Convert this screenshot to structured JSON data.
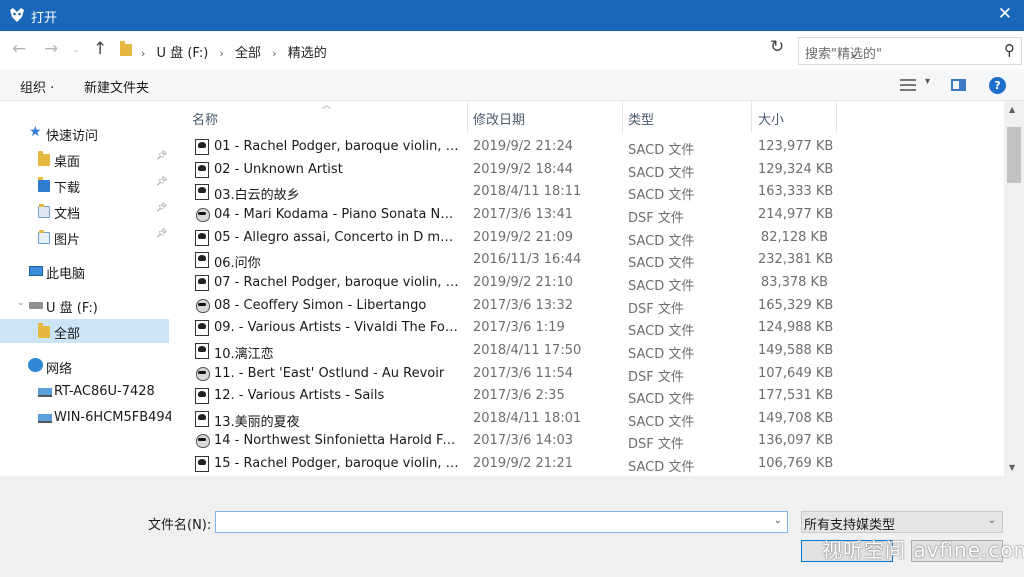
{
  "window": {
    "title": "打开",
    "close_glyph": "✕"
  },
  "address": {
    "breadcrumbs": [
      "U 盘 (F:)",
      "全部",
      "精选的"
    ],
    "search_placeholder": "搜索\"精选的\""
  },
  "toolbar": {
    "organize": "组织 ·",
    "new_folder": "新建文件夹"
  },
  "nav": {
    "quick_access": "快速访问",
    "quick_items": [
      {
        "label": "桌面",
        "pinned": true
      },
      {
        "label": "下载",
        "pinned": true
      },
      {
        "label": "文档",
        "pinned": true
      },
      {
        "label": "图片",
        "pinned": true
      }
    ],
    "this_pc": "此电脑",
    "drive": "U 盘 (F:)",
    "drive_child": "全部",
    "network": "网络",
    "network_items": [
      "RT-AC86U-7428",
      "WIN-6HCM5FB494"
    ]
  },
  "columns": {
    "name": "名称",
    "date": "修改日期",
    "type": "类型",
    "size": "大小"
  },
  "files": [
    {
      "name": "01 - Rachel Podger, baroque violin, A...",
      "date": "2019/9/2 21:24",
      "type": "SACD 文件",
      "size": "123,977 KB",
      "icon": "sacd-file-icon"
    },
    {
      "name": "02 - Unknown Artist",
      "date": "2019/9/2 18:44",
      "type": "SACD 文件",
      "size": "129,324 KB",
      "icon": "sacd-file-icon"
    },
    {
      "name": "03.白云的故乡",
      "date": "2018/4/11 18:11",
      "type": "SACD 文件",
      "size": "163,333 KB",
      "icon": "sacd-file-icon"
    },
    {
      "name": "04 - Mari Kodama - Piano Sonata No....",
      "date": "2017/3/6 13:41",
      "type": "DSF 文件",
      "size": "214,977 KB",
      "icon": "dsf-file-icon"
    },
    {
      "name": "05 - Allegro assai, Concerto in D maj...",
      "date": "2019/9/2 21:09",
      "type": "SACD 文件",
      "size": "82,128 KB",
      "icon": "sacd-file-icon"
    },
    {
      "name": "06.问你",
      "date": "2016/11/3 16:44",
      "type": "SACD 文件",
      "size": "232,381 KB",
      "icon": "sacd-file-icon"
    },
    {
      "name": "07 - Rachel Podger, baroque violin, A...",
      "date": "2019/9/2 21:10",
      "type": "SACD 文件",
      "size": "83,378 KB",
      "icon": "sacd-file-icon"
    },
    {
      "name": "08 - Ceoffery Simon - Libertango",
      "date": "2017/3/6 13:32",
      "type": "DSF 文件",
      "size": "165,329 KB",
      "icon": "dsf-file-icon"
    },
    {
      "name": "09. - Various Artists - Vivaldi The Fou...",
      "date": "2017/3/6 1:19",
      "type": "SACD 文件",
      "size": "124,988 KB",
      "icon": "sacd-file-icon"
    },
    {
      "name": "10.漓江恋",
      "date": "2018/4/11 17:50",
      "type": "SACD 文件",
      "size": "149,588 KB",
      "icon": "sacd-file-icon"
    },
    {
      "name": "11. - Bert 'East' Ostlund - Au Revoir",
      "date": "2017/3/6 11:54",
      "type": "DSF 文件",
      "size": "107,649 KB",
      "icon": "dsf-file-icon"
    },
    {
      "name": "12. - Various Artists - Sails",
      "date": "2017/3/6 2:35",
      "type": "SACD 文件",
      "size": "177,531 KB",
      "icon": "sacd-file-icon"
    },
    {
      "name": "13.美丽的夏夜",
      "date": "2018/4/11 18:01",
      "type": "SACD 文件",
      "size": "149,708 KB",
      "icon": "sacd-file-icon"
    },
    {
      "name": "14 - Northwest Sinfonietta Harold Far...",
      "date": "2017/3/6 14:03",
      "type": "DSF 文件",
      "size": "136,097 KB",
      "icon": "dsf-file-icon"
    },
    {
      "name": "15 - Rachel Podger, baroque violin, A...",
      "date": "2019/9/2 21:21",
      "type": "SACD 文件",
      "size": "106,769 KB",
      "icon": "sacd-file-icon"
    }
  ],
  "bottom": {
    "filename_label": "文件名(N):",
    "filename_value": "",
    "filter_value": "所有支持媒类型"
  },
  "watermark": "视听空间 avfine.com"
}
